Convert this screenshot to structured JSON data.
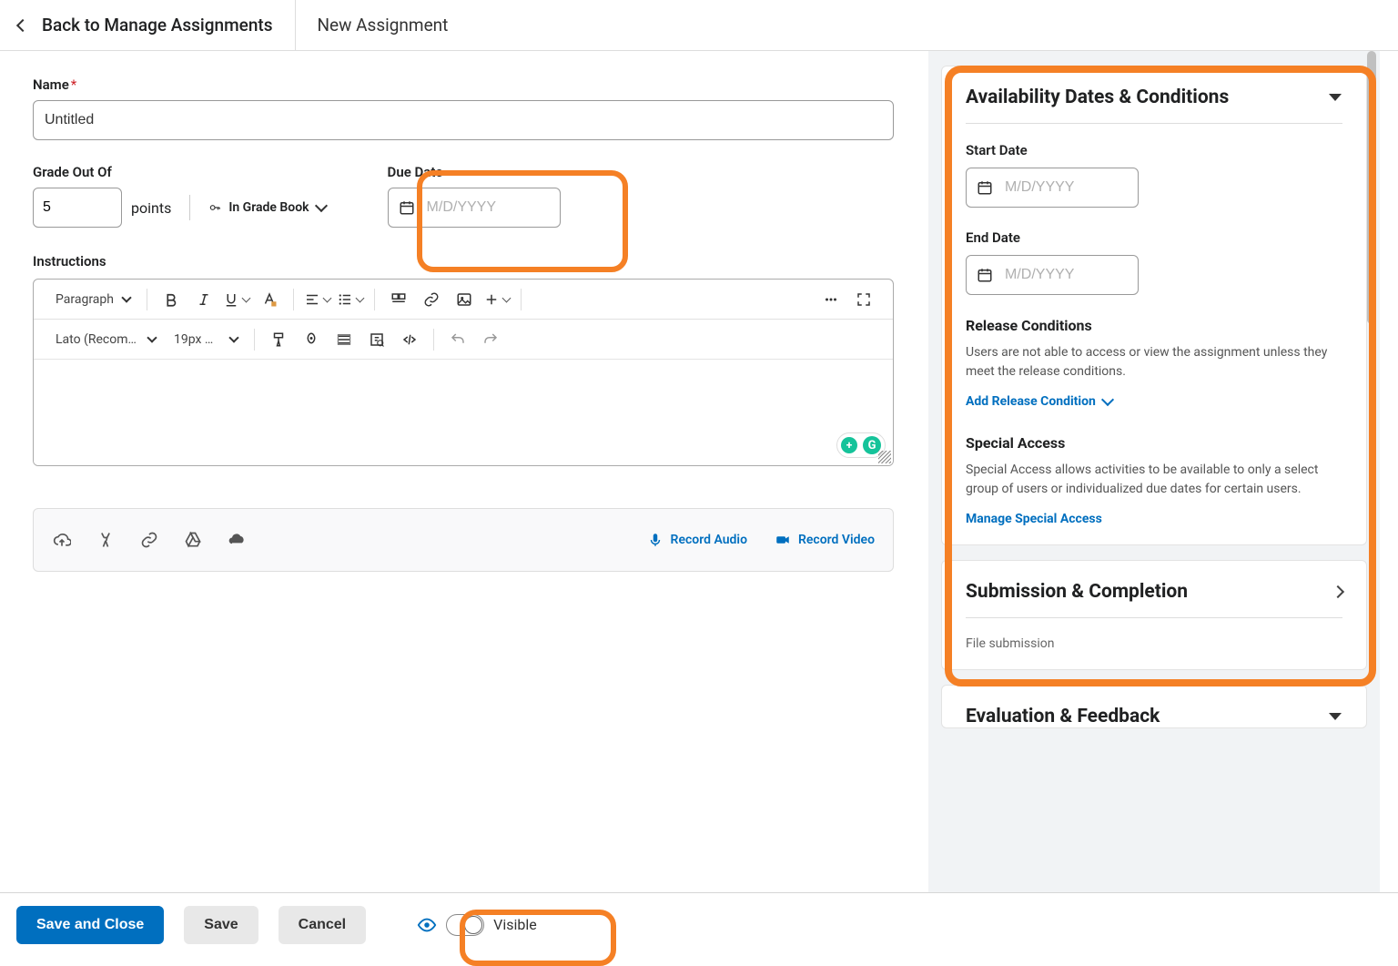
{
  "topbar": {
    "back_label": "Back to Manage Assignments",
    "page_title": "New Assignment"
  },
  "form": {
    "name_label": "Name",
    "name_value": "Untitled",
    "grade_label": "Grade Out Of",
    "grade_value": "5",
    "points_label": "points",
    "gradebook_label": "In Grade Book",
    "due_label": "Due Date",
    "date_placeholder": "M/D/YYYY",
    "instructions_label": "Instructions"
  },
  "editor": {
    "block_format": "Paragraph",
    "font_family": "Lato (Recom…",
    "font_size": "19px …"
  },
  "media": {
    "record_audio": "Record Audio",
    "record_video": "Record Video"
  },
  "availability": {
    "title": "Availability Dates & Conditions",
    "start_label": "Start Date",
    "end_label": "End Date",
    "date_placeholder": "M/D/YYYY",
    "release_title": "Release Conditions",
    "release_desc": "Users are not able to access or view the assignment unless they meet the release conditions.",
    "release_action": "Add Release Condition",
    "special_title": "Special Access",
    "special_desc": "Special Access allows activities to be available to only a select group of users or individualized due dates for certain users.",
    "special_action": "Manage Special Access"
  },
  "submission": {
    "title": "Submission & Completion",
    "sub": "File submission"
  },
  "evaluation": {
    "title": "Evaluation & Feedback"
  },
  "footer": {
    "save_close": "Save and Close",
    "save": "Save",
    "cancel": "Cancel",
    "visible": "Visible"
  }
}
